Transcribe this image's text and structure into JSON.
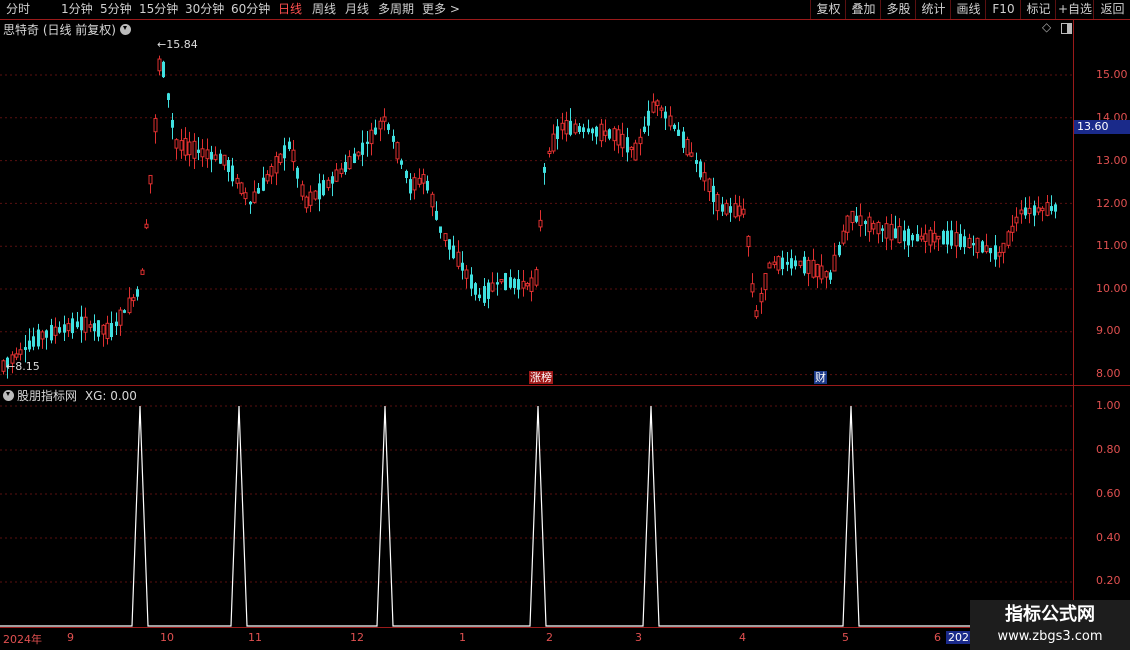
{
  "toolbar": {
    "periods": [
      "分时",
      "1分钟",
      "5分钟",
      "15分钟",
      "30分钟",
      "60分钟",
      "日线",
      "周线",
      "月线",
      "多周期",
      "更多 >"
    ],
    "active_period": "日线",
    "right_buttons": [
      "复权",
      "叠加",
      "多股",
      "统计",
      "画线",
      "F10",
      "标记",
      "+自选",
      "返回"
    ]
  },
  "main_chart": {
    "title": "思特奇 (日线 前复权)",
    "y_ticks": [
      "15.00",
      "14.00",
      "13.00",
      "12.00",
      "11.00",
      "10.00",
      "9.00",
      "8.00"
    ],
    "current_price": "13.60",
    "high_label": "15.84",
    "low_label": "8.15",
    "badges": {
      "limit": "涨榜",
      "finance": "财"
    }
  },
  "indicator": {
    "title": "股朋指标网",
    "value_text": "XG: 0.00",
    "y_ticks": [
      "1.00",
      "0.80",
      "0.60",
      "0.40",
      "0.20"
    ]
  },
  "x_axis": {
    "labels": [
      "2024年",
      "9",
      "10",
      "11",
      "12",
      "1",
      "2",
      "3",
      "4",
      "5",
      "6",
      "2025"
    ]
  },
  "watermark": {
    "line1": "指标公式网",
    "line2": "www.zbgs3.com"
  },
  "colors": {
    "up": "#e03030",
    "down": "#40e0e0",
    "grid": "#5a1010",
    "border": "#9a1a1a",
    "price_box": "#1a2a8a"
  }
}
